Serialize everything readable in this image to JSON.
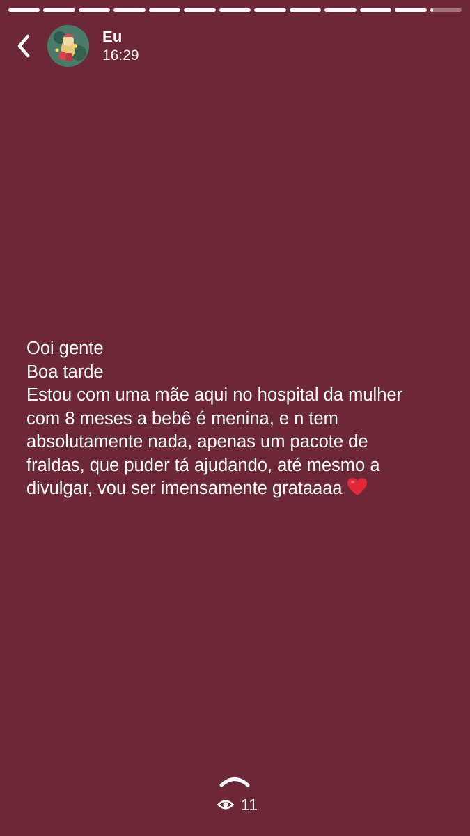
{
  "story": {
    "author": "Eu",
    "time": "16:29",
    "segments": [
      1,
      1,
      1,
      1,
      1,
      1,
      1,
      1,
      1,
      1,
      1,
      1,
      0.1
    ],
    "lines": [
      "Ooi gente",
      "Boa tarde",
      "Estou com uma mãe aqui no hospital da mulher",
      "com 8 meses a bebê é menina, e n tem",
      "absolutamente nada, apenas um pacote de",
      "fraldas, que puder tá ajudando, até mesmo a",
      "divulgar, vou ser imensamente grataaaa"
    ],
    "emoji": "heart-icon",
    "views": "11"
  },
  "colors": {
    "background": "#6d2838",
    "text": "#ffffff",
    "heart": "#e0283a"
  },
  "icons": {
    "back": "chevron-left-icon",
    "swipe": "chevron-up-icon",
    "views": "eye-icon"
  }
}
